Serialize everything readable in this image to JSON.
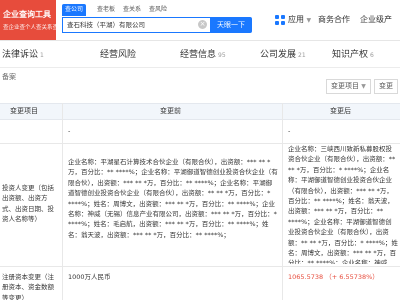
{
  "header": {
    "logo_line1": "企业查询工具",
    "logo_line2": "查企业查个人查关系查风险就上企查查",
    "search_tabs": [
      "查公司",
      "查老板",
      "查关系",
      "查风险"
    ],
    "search_value": "查石科技（平湖）有限公司",
    "search_button": "天眼一下",
    "nav_apps": "应用",
    "nav_cooperation": "商务合作",
    "nav_enterprise": "企业级产"
  },
  "category_tabs": [
    {
      "label": "法律诉讼",
      "count": "1"
    },
    {
      "label": "经营风险",
      "count": ""
    },
    {
      "label": "经营信息",
      "count": "95"
    },
    {
      "label": "公司发展",
      "count": "21"
    },
    {
      "label": "知识产权",
      "count": "6"
    }
  ],
  "table": {
    "section_label": "备案",
    "filter_item": "变更项目",
    "filter_time": "变更",
    "headers": [
      "变更项目",
      "变更前",
      "变更后"
    ],
    "rows": [
      {
        "item": "",
        "before": "-",
        "after": "-"
      },
      {
        "item": "投资人变更（包括出资额、出资方式、出资日期、投资人名称等）",
        "before": "企业名称：平湖星石计算技术合伙企业（有限合伙），出资额：*** ** *万，百分比：** ****%；企业名称：平湖御道智德创业投资合伙企业（有限合伙），出资额：*** ** *万，百分比：** ****%；企业名称：平湖御道智德创业投资合伙企业（有限合伙），出资额：** ** *万，百分比：* ****%；姓名：周博文，出资额：*** ** *万，百分比：** ****%；企业名称：神威（无锡）信息产业有限公司，出资额：*** ** *万，百分比：* ****%；姓名：毛启航，出资额：*** ** *万，百分比：** ****%；姓名：翁天波，出资额：*** ** *万，百分比：** ****%；",
        "after": "企业名称：三峡西川致新私募股权投资合伙企业（有限合伙），出资额：** ** *万，百分比：* ****%；企业名称：平湖御道智德创业投资合伙企业（有限合伙），出资额：*** ** *万，百分比：** ****%；姓名：翁天波，出资额：*** ** *万，百分比：** ****%；企业名称：平湖御道智德创业投资合伙企业（有限合伙），出资额：** ** *万，百分比：* ****%；姓名：周博文，出资额：*** ** *万，百分比：** ****%；企业名称：神威（无锡）信息产业有限公司，出资额：*** ** *万，百分比：* ****%；企业名称：平湖星石计算技术合伙企业（有限合伙），出资额：*** ** *万，百分比：** ****%；姓名：毛启航，出资额：*** ** *万，百分比：** ****%；"
      },
      {
        "item": "注册资本变更（注册资本、资金数额等变更）",
        "before": "1000万人民币",
        "after_value": "1065.5738",
        "after_change": "（+ 6.55738%）"
      }
    ]
  }
}
